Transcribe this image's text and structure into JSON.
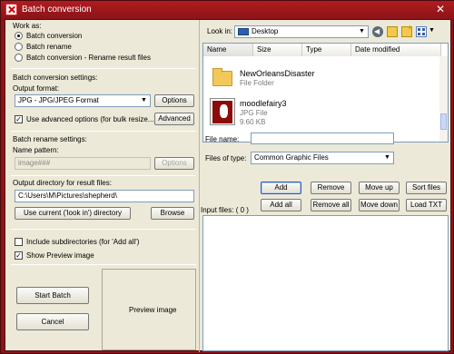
{
  "window": {
    "title": "Batch conversion"
  },
  "left": {
    "work_as_label": "Work as:",
    "radios": [
      {
        "label": "Batch conversion",
        "selected": true
      },
      {
        "label": "Batch rename",
        "selected": false
      },
      {
        "label": "Batch conversion - Rename result files",
        "selected": false
      }
    ],
    "conversion_settings_label": "Batch conversion settings:",
    "output_format_label": "Output format:",
    "output_format_value": "JPG - JPG/JPEG Format",
    "options_label": "Options",
    "advanced_check_label": "Use advanced options (for bulk resize...)",
    "advanced_checked": true,
    "advanced_label": "Advanced",
    "rename_settings_label": "Batch rename settings:",
    "name_pattern_label": "Name pattern:",
    "name_pattern_value": "image###",
    "rename_options_label": "Options",
    "output_dir_label": "Output directory for result files:",
    "output_dir_value": "C:\\Users\\M\\Pictures\\shepherd\\",
    "use_current_label": "Use current ('look in') directory",
    "browse_label": "Browse",
    "include_subdirs_label": "Include subdirectories (for 'Add all')",
    "include_subdirs_checked": false,
    "show_preview_label": "Show Preview image",
    "show_preview_checked": true,
    "start_batch_label": "Start Batch",
    "cancel_label": "Cancel",
    "preview_label": "Preview image"
  },
  "right": {
    "look_in_label": "Look in:",
    "look_in_value": "Desktop",
    "columns": [
      "Name",
      "Size",
      "Type",
      "Date modified"
    ],
    "files": [
      {
        "name": "NewOrleansDisaster",
        "type": "File Folder",
        "extra": "",
        "icon": "folder-icon"
      },
      {
        "name": "moodlefairy3",
        "type": "JPG File",
        "extra": "9.60 KB",
        "icon": "image-thumbnail"
      }
    ],
    "file_name_label": "File name:",
    "file_name_value": "",
    "files_of_type_label": "Files of type:",
    "files_of_type_value": "Common Graphic Files",
    "buttons_row1": [
      "Add",
      "Remove",
      "Move up",
      "Sort files"
    ],
    "buttons_row2": [
      "Add all",
      "Remove all",
      "Move down",
      "Load TXT"
    ],
    "input_files_label": "Input files: ( 0 )"
  },
  "colors": {
    "title_bar": "#8a1418",
    "dialog_bg": "#ece9d8",
    "field_border": "#7f9db9"
  }
}
